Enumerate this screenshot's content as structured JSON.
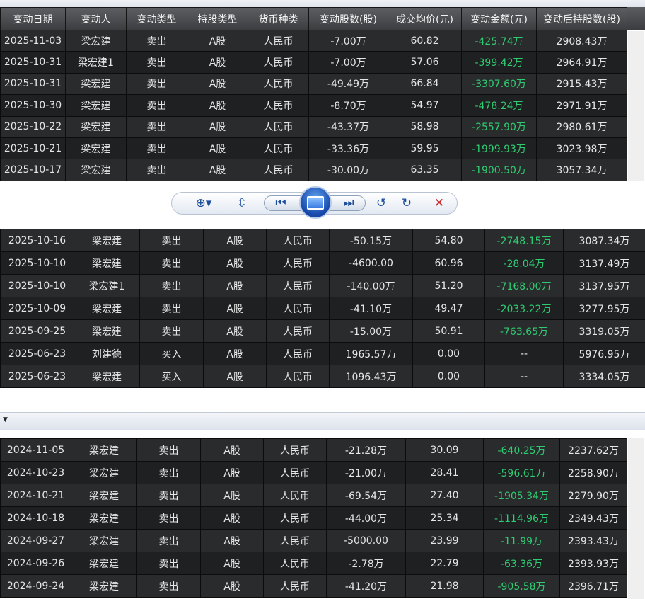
{
  "table1": {
    "headers": [
      "变动日期",
      "变动人",
      "变动类型",
      "持股类型",
      "货币种类",
      "变动股数(股)",
      "成交均价(元)",
      "变动金额(元)",
      "变动后持股数(股)"
    ],
    "rows": [
      [
        "2025-11-03",
        "梁宏建",
        "卖出",
        "A股",
        "人民币",
        "-7.00万",
        "60.82",
        "-425.74万",
        "2908.43万"
      ],
      [
        "2025-10-31",
        "梁宏建1",
        "卖出",
        "A股",
        "人民币",
        "-7.00万",
        "57.06",
        "-399.42万",
        "2964.91万"
      ],
      [
        "2025-10-31",
        "梁宏建",
        "卖出",
        "A股",
        "人民币",
        "-49.49万",
        "66.84",
        "-3307.60万",
        "2915.43万"
      ],
      [
        "2025-10-30",
        "梁宏建",
        "卖出",
        "A股",
        "人民币",
        "-8.70万",
        "54.97",
        "-478.24万",
        "2971.91万"
      ],
      [
        "2025-10-22",
        "梁宏建",
        "卖出",
        "A股",
        "人民币",
        "-43.37万",
        "58.98",
        "-2557.90万",
        "2980.61万"
      ],
      [
        "2025-10-21",
        "梁宏建",
        "卖出",
        "A股",
        "人民币",
        "-33.36万",
        "59.95",
        "-1999.93万",
        "3023.98万"
      ],
      [
        "2025-10-17",
        "梁宏建",
        "卖出",
        "A股",
        "人民币",
        "-30.00万",
        "63.35",
        "-1900.50万",
        "3057.34万"
      ]
    ]
  },
  "toolbar": {
    "zoom_icon": "zoom-in-icon",
    "fit_icon": "fit-window-icon",
    "prev_icon": "previous-image-icon",
    "center_icon": "slideshow-icon",
    "next_icon": "next-image-icon",
    "rotate_left_icon": "rotate-left-icon",
    "rotate_right_icon": "rotate-right-icon",
    "delete_icon": "delete-icon",
    "zoom_glyph": "⊕▾",
    "fit_glyph": "⇳",
    "prev_glyph": "⏮",
    "next_glyph": "⏭",
    "rotl_glyph": "↺",
    "rotr_glyph": "↻",
    "del_glyph": "✕"
  },
  "table2": {
    "rows": [
      [
        "2025-10-16",
        "梁宏建",
        "卖出",
        "A股",
        "人民币",
        "-50.15万",
        "54.80",
        "-2748.15万",
        "3087.34万"
      ],
      [
        "2025-10-10",
        "梁宏建",
        "卖出",
        "A股",
        "人民币",
        "-4600.00",
        "60.96",
        "-28.04万",
        "3137.49万"
      ],
      [
        "2025-10-10",
        "梁宏建1",
        "卖出",
        "A股",
        "人民币",
        "-140.00万",
        "51.20",
        "-7168.00万",
        "3137.95万"
      ],
      [
        "2025-10-09",
        "梁宏建",
        "卖出",
        "A股",
        "人民币",
        "-41.10万",
        "49.47",
        "-2033.22万",
        "3277.95万"
      ],
      [
        "2025-09-25",
        "梁宏建",
        "卖出",
        "A股",
        "人民币",
        "-15.00万",
        "50.91",
        "-763.65万",
        "3319.05万"
      ],
      [
        "2025-06-23",
        "刘建德",
        "买入",
        "A股",
        "人民币",
        "1965.57万",
        "0.00",
        "--",
        "5976.95万"
      ],
      [
        "2025-06-23",
        "梁宏建",
        "买入",
        "A股",
        "人民币",
        "1096.43万",
        "0.00",
        "--",
        "3334.05万"
      ]
    ]
  },
  "filterbar": {
    "caret": "▼"
  },
  "table3": {
    "rows": [
      [
        "2024-11-05",
        "梁宏建",
        "卖出",
        "A股",
        "人民币",
        "-21.28万",
        "30.09",
        "-640.25万",
        "2237.62万"
      ],
      [
        "2024-10-23",
        "梁宏建",
        "卖出",
        "A股",
        "人民币",
        "-21.00万",
        "28.41",
        "-596.61万",
        "2258.90万"
      ],
      [
        "2024-10-21",
        "梁宏建",
        "卖出",
        "A股",
        "人民币",
        "-69.54万",
        "27.40",
        "-1905.34万",
        "2279.90万"
      ],
      [
        "2024-10-18",
        "梁宏建",
        "卖出",
        "A股",
        "人民币",
        "-44.00万",
        "25.34",
        "-1114.96万",
        "2349.43万"
      ],
      [
        "2024-09-27",
        "梁宏建",
        "卖出",
        "A股",
        "人民币",
        "-5000.00",
        "23.99",
        "-11.99万",
        "2393.43万"
      ],
      [
        "2024-09-26",
        "梁宏建",
        "卖出",
        "A股",
        "人民币",
        "-2.78万",
        "22.79",
        "-63.36万",
        "2393.93万"
      ],
      [
        "2024-09-24",
        "梁宏建",
        "卖出",
        "A股",
        "人民币",
        "-41.20万",
        "21.98",
        "-905.58万",
        "2396.71万"
      ]
    ]
  },
  "colors": {
    "negative_amount": "#2ecc71",
    "row_bg": "#2a2b2d",
    "header_bg": "#4a4c50"
  }
}
